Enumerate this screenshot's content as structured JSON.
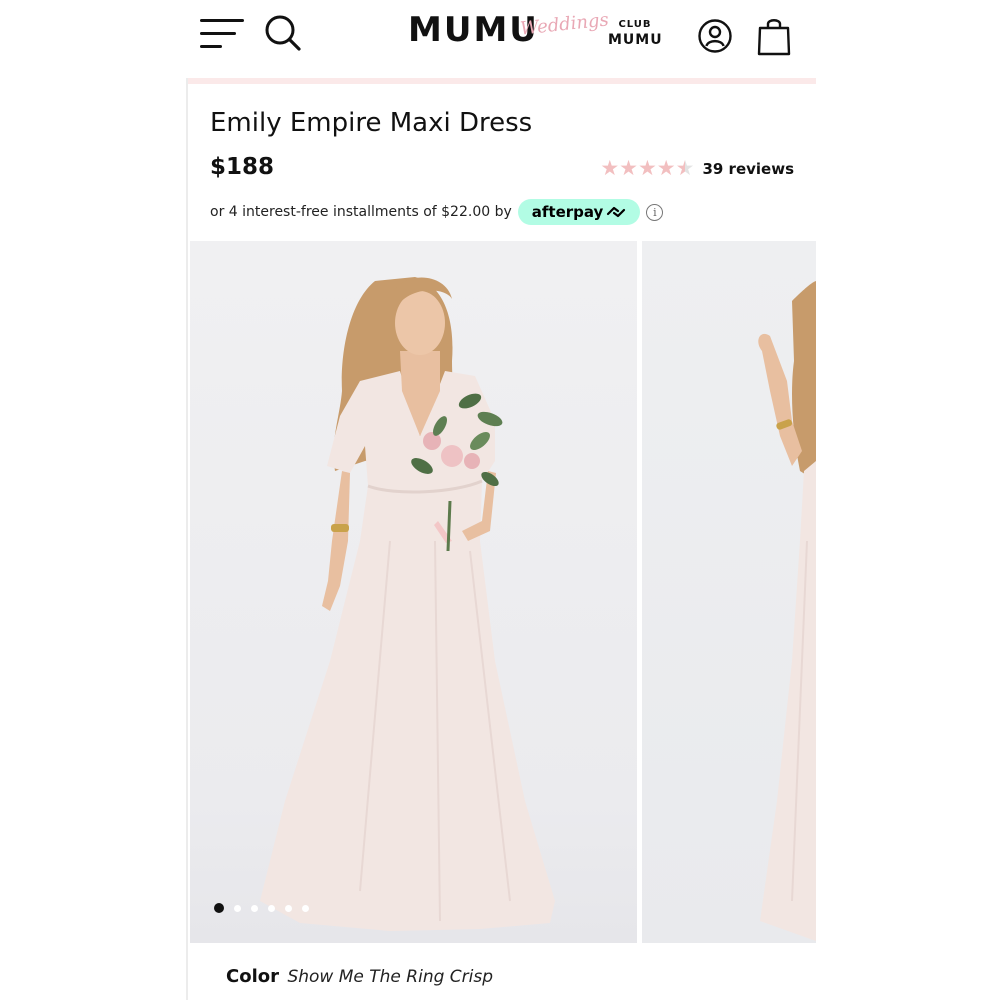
{
  "header": {
    "logo_main": "MUMU",
    "logo_script": "Weddings",
    "club_logo_line1": "CLUB",
    "club_logo_line2": "MUMU"
  },
  "product": {
    "title": "Emily Empire Maxi Dress",
    "price": "$188",
    "rating": 4.5,
    "rating_max": 5,
    "reviews": "39 reviews",
    "installments_text": "or 4 interest-free installments of $22.00 by",
    "afterpay_label": "afterpay",
    "info_symbol": "i"
  },
  "gallery": {
    "image_count": 6,
    "active_index": 0
  },
  "color": {
    "label": "Color",
    "value": "Show Me The Ring Crisp"
  },
  "colors": {
    "star": "#f2bfc0",
    "afterpay_bg": "#b2fce4",
    "logo_script": "#e9a8b5"
  },
  "icons": [
    "menu-icon",
    "search-icon",
    "account-icon",
    "bag-icon",
    "star-icon",
    "afterpay-loop-icon",
    "info-icon"
  ]
}
